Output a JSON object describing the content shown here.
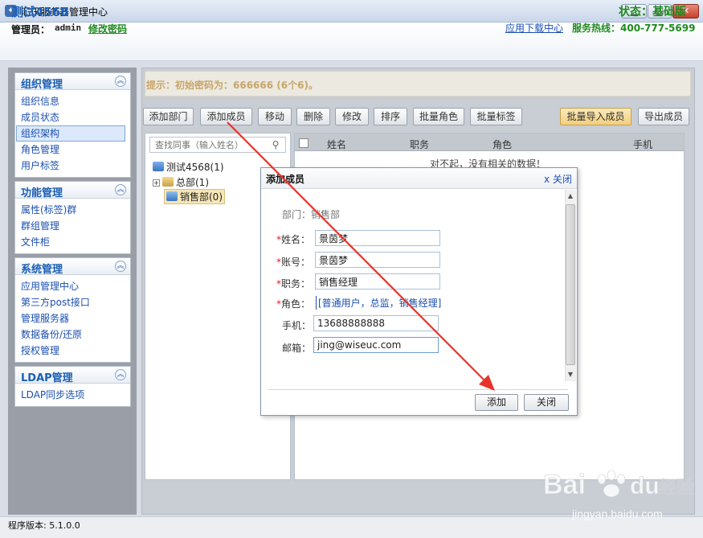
{
  "window": {
    "title": "汇讯服务器管理中心",
    "app_icon": "app-logo-icon",
    "controls": [
      "minimize-icon",
      "maximize-icon",
      "close-icon"
    ]
  },
  "header": {
    "org_name": "测试4568",
    "admin_label": "管理员：",
    "admin_name": "admin",
    "change_password": "修改密码",
    "status": "状态：基础版",
    "app_download": "应用下载中心",
    "hotline": "服务热线：400-777-5699",
    "colors": {
      "brand": "#1b5fb3",
      "green": "#1f8a1f"
    }
  },
  "sidebar": {
    "panels": [
      {
        "title": "组织管理",
        "items": [
          "组织信息",
          "成员状态",
          "组织架构",
          "角色管理",
          "用户标签"
        ],
        "active_index": 2
      },
      {
        "title": "功能管理",
        "items": [
          "属性(标签)群",
          "群组管理",
          "文件柜"
        ]
      },
      {
        "title": "系统管理",
        "items": [
          "应用管理中心",
          "第三方post接口",
          "管理服务器",
          "数据备份/还原",
          "授权管理"
        ]
      },
      {
        "title": "LDAP管理",
        "items": [
          "LDAP同步选项"
        ]
      }
    ]
  },
  "main": {
    "tip": "提示：初始密码为：666666 (6个6)。",
    "toolbar": [
      "添加部门",
      "添加成员",
      "移动",
      "删除",
      "修改",
      "排序",
      "批量角色",
      "批量标签"
    ],
    "toolbar_right": [
      "批量导入成员",
      "导出成员"
    ],
    "tree": {
      "search_placeholder": "查找同事（输入姓名）",
      "nodes": [
        "测试4568(1)",
        "总部(1)",
        "销售部(0)"
      ],
      "selected": "销售部(0)"
    },
    "list": {
      "columns": [
        "姓名",
        "职务",
        "角色",
        "手机"
      ],
      "empty_message": "对不起，没有相关的数据！"
    }
  },
  "dialog": {
    "title": "添加成员",
    "close_link": "x 关闭",
    "department": "部门：销售部",
    "fields": {
      "name": {
        "label": "姓名：",
        "value": "景茵梦"
      },
      "account": {
        "label": "账号：",
        "value": "景茵梦"
      },
      "position": {
        "label": "职务：",
        "value": "销售经理"
      },
      "role": {
        "label": "角色：",
        "value": "[普通用户，总监，销售经理]"
      },
      "phone": {
        "label": "手机：",
        "value": "13688888888"
      },
      "email": {
        "label": "邮箱：",
        "value": "jing@wiseuc.com"
      }
    },
    "buttons": {
      "add": "添加",
      "close": "关闭"
    }
  },
  "statusbar": {
    "version": "程序版本: 5.1.0.0"
  },
  "watermark": {
    "brand": "Bai du 经验",
    "url": "jingyan.baidu.com"
  }
}
